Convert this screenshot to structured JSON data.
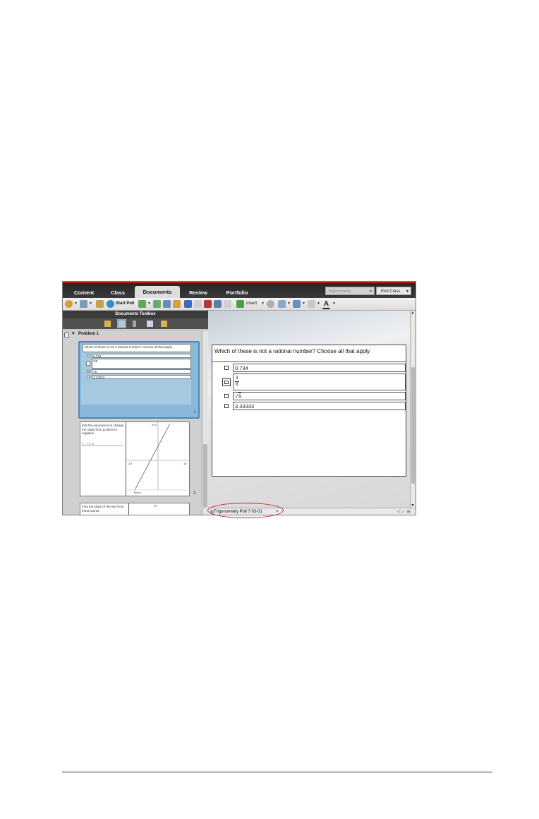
{
  "tabs": [
    {
      "label": "Content",
      "active": false
    },
    {
      "label": "Class",
      "active": false
    },
    {
      "label": "Documents",
      "active": true
    },
    {
      "label": "Review",
      "active": false
    },
    {
      "label": "Portfolio",
      "active": false
    }
  ],
  "class_select": {
    "value": "Trigonometry"
  },
  "end_class": {
    "label": "End Class"
  },
  "toolbar": {
    "start_poll_label": "Start Poll",
    "insert_label": "Insert"
  },
  "left_panel": {
    "toolbox_title": "Documents Toolbox",
    "problem_label": "Problem 1",
    "page1": {
      "question": "Which of these is not a rational number? Choose all that apply.",
      "choices": [
        "0.734",
        "3/8",
        "√5",
        "3.33333"
      ],
      "page_number": "1"
    },
    "page2": {
      "text": "Edit the expression to change the slope from positive to negative.",
      "expr": "y = 1x+2",
      "graph_label": "f1(x)=",
      "ymax": "6.67",
      "xmin": "-10",
      "xmax": "10",
      "page_number": "2"
    },
    "page3": {
      "text": "Find the slope of the line from these points.",
      "value": "10"
    }
  },
  "document": {
    "question": "Which of these is not a rational number? Choose all that apply.",
    "choices": [
      {
        "text": "0.734"
      },
      {
        "numerator": "3",
        "denominator": "8"
      },
      {
        "radicand": "5"
      },
      {
        "text": "3.33333"
      }
    ]
  },
  "doc_tab": {
    "label": "Trigonometry Poll 7 03-01",
    "close": "×"
  },
  "colors": {
    "accent_red": "#d21c1c",
    "tab_bar": "#2e2e2e",
    "selected_page": "#8ab8d8"
  }
}
